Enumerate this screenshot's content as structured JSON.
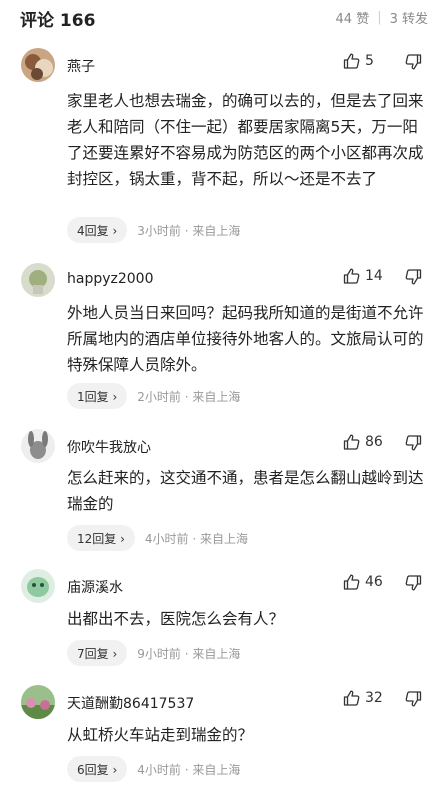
{
  "header": {
    "title": "评论 166",
    "likes": "44 赞",
    "reposts": "3 转发",
    "separator": "|"
  },
  "comments": [
    {
      "user": "燕子",
      "likes": "5",
      "text": "家里老人也想去瑞金，的确可以去的，但是去了回来老人和陪同（不住一起）都要居家隔离5天，万一阳了还要连累好不容易成为防范区的两个小区都再次成封控区，锅太重，背不起，所以～还是不去了",
      "replies": "4回复 ›",
      "time": "3小时前 · 来自上海"
    },
    {
      "user": "happyz2000",
      "likes": "14",
      "text": "外地人员当日来回吗？起码我所知道的是街道不允许所属地内的酒店单位接待外地客人的。文旅局认可的特殊保障人员除外。",
      "replies": "1回复 ›",
      "time": "2小时前 · 来自上海"
    },
    {
      "user": "你吹牛我放心",
      "likes": "86",
      "text": "怎么赶来的，这交通不通，患者是怎么翻山越岭到达瑞金的",
      "replies": "12回复 ›",
      "time": "4小时前 · 来自上海"
    },
    {
      "user": "庙源溪水",
      "likes": "46",
      "text": "出都出不去，医院怎么会有人？",
      "replies": "7回复 ›",
      "time": "9小时前 · 来自上海"
    },
    {
      "user": "天道酬勤86417537",
      "likes": "32",
      "text": "从虹桥火车站走到瑞金的？",
      "replies": "6回复 ›",
      "time": "4小时前 · 来自上海"
    }
  ],
  "icons": {
    "like": "thumbs-up-outline",
    "dislike": "thumbs-down-outline"
  },
  "colors": {
    "text": "#222222",
    "meta": "#999999",
    "pill_bg": "#f1f1f1"
  }
}
